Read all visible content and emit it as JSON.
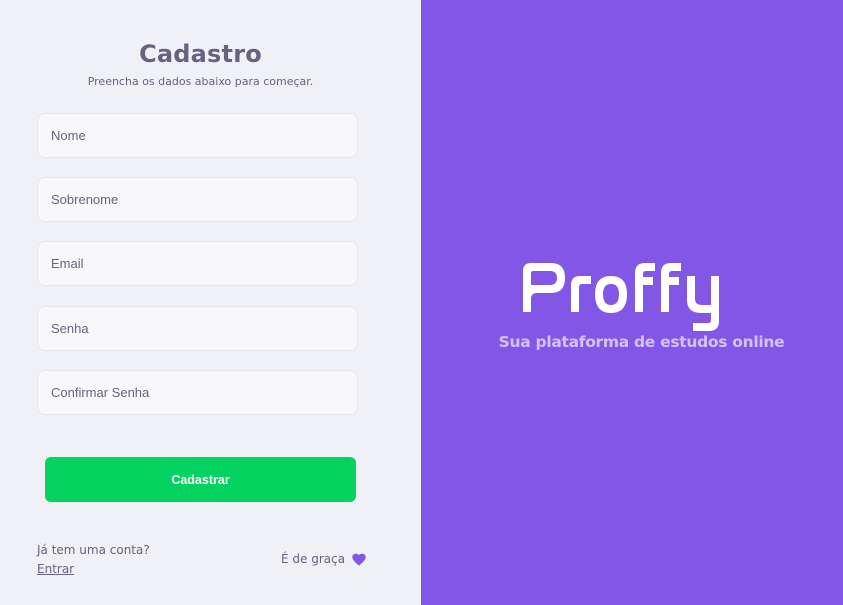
{
  "form": {
    "title": "Cadastro",
    "subtitle": "Preencha os dados abaixo para começar.",
    "fields": [
      {
        "placeholder": "Nome",
        "value": ""
      },
      {
        "placeholder": "Sobrenome",
        "value": ""
      },
      {
        "placeholder": "Email",
        "value": ""
      },
      {
        "placeholder": "Senha",
        "value": ""
      },
      {
        "placeholder": "Confirmar Senha",
        "value": ""
      }
    ],
    "submit_label": "Cadastrar"
  },
  "footer": {
    "has_account_text": "Já tem uma conta?",
    "login_link": "Entrar",
    "free_text": "É de graça",
    "heart_icon": "heart-icon"
  },
  "brand": {
    "logo_text": "Proffy",
    "tagline": "Sua plataforma de estudos online"
  },
  "colors": {
    "brand_purple": "#8257e5",
    "button_green": "#04d361",
    "text": "#6a6180",
    "tagline": "#d4c2ff",
    "background": "#f0f0f7"
  }
}
